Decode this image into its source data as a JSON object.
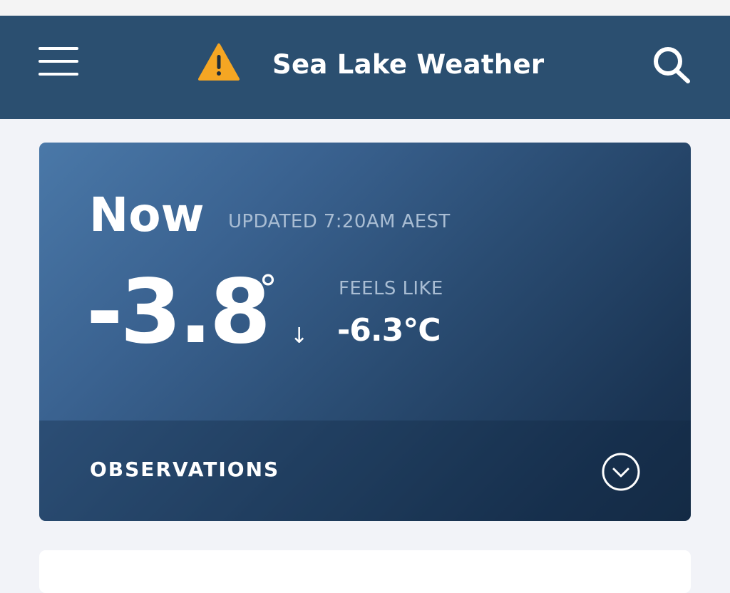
{
  "header": {
    "title": "Sea Lake Weather",
    "background": "#2b4f70",
    "warning_icon": "warning-triangle-icon",
    "warning_color": "#f5a623",
    "menu_icon": "hamburger-menu-icon",
    "search_icon": "search-icon"
  },
  "current": {
    "now_label": "Now",
    "updated": "UPDATED 7:20AM AEST",
    "temperature": "-3.8",
    "degree": "°",
    "trend": "↓",
    "trend_icon": "arrow-down-icon",
    "feels_like_label": "FEELS LIKE",
    "feels_like_value": "-6.3°C"
  },
  "observations": {
    "label": "OBSERVATIONS",
    "expand_icon": "chevron-down-circle-icon"
  }
}
